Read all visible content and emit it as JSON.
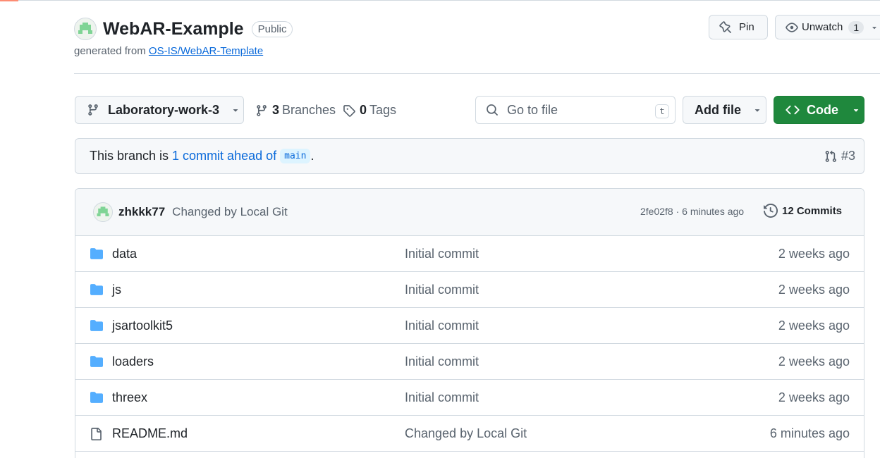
{
  "repo": {
    "name": "WebAR-Example",
    "visibility": "Public",
    "generated_prefix": "generated from",
    "template_link": "OS-IS/WebAR-Template"
  },
  "header_actions": {
    "pin_label": "Pin",
    "watch_label": "Unwatch",
    "watch_count": "1"
  },
  "toolbar": {
    "branch": "Laboratory-work-3",
    "branches_count": "3",
    "branches_label": "Branches",
    "tags_count": "0",
    "tags_label": "Tags",
    "search_placeholder": "Go to file",
    "search_shortcut": "t",
    "add_file_label": "Add file",
    "code_label": "Code"
  },
  "ahead_banner": {
    "prefix": "This branch is",
    "link": "1 commit ahead of",
    "base": "main",
    "suffix": ".",
    "pr_ref": "#3"
  },
  "latest_commit": {
    "author": "zhkkk77",
    "message": "Changed by Local Git",
    "hash_time": "2fe02f8 · 6 minutes ago",
    "commits_label": "12 Commits"
  },
  "files": [
    {
      "name": "data",
      "type": "folder",
      "message": "Initial commit",
      "age": "2 weeks ago"
    },
    {
      "name": "js",
      "type": "folder",
      "message": "Initial commit",
      "age": "2 weeks ago"
    },
    {
      "name": "jsartoolkit5",
      "type": "folder",
      "message": "Initial commit",
      "age": "2 weeks ago"
    },
    {
      "name": "loaders",
      "type": "folder",
      "message": "Initial commit",
      "age": "2 weeks ago"
    },
    {
      "name": "threex",
      "type": "folder",
      "message": "Initial commit",
      "age": "2 weeks ago"
    },
    {
      "name": "README.md",
      "type": "file",
      "message": "Changed by Local Git",
      "age": "6 minutes ago"
    }
  ],
  "colors": {
    "accent_blue": "#0969da",
    "code_green": "#1f883d",
    "folder_blue": "#54aeff",
    "muted_text": "#59636e",
    "border": "#d1d9e0"
  },
  "icons": [
    "repo-avatar-icon",
    "pin-icon",
    "eye-icon",
    "branch-icon",
    "tag-icon",
    "search-icon",
    "code-icon",
    "pull-request-icon",
    "history-icon",
    "folder-icon",
    "file-icon",
    "caret-down-icon"
  ]
}
